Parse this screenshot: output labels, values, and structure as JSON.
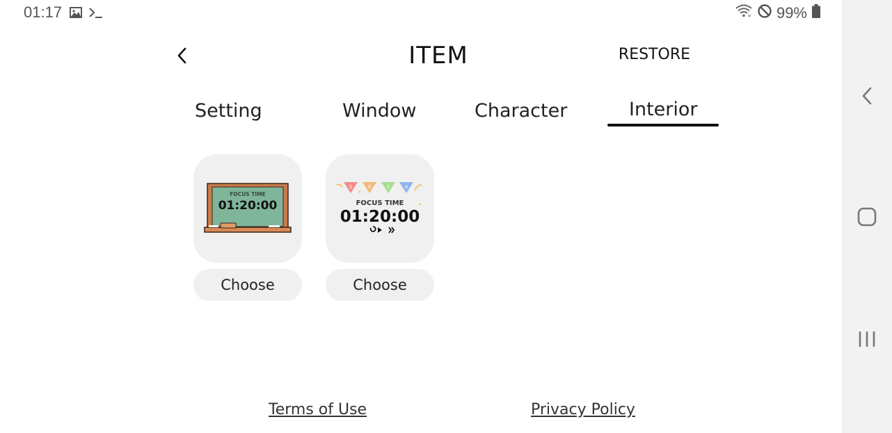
{
  "status_bar": {
    "time": "01:17",
    "battery_percent": "99%",
    "left_icons": [
      "image-icon",
      "terminal-icon"
    ],
    "right_icons": [
      "wifi-icon",
      "do-not-disturb-icon",
      "battery-icon"
    ]
  },
  "header": {
    "title": "ITEM",
    "restore_label": "RESTORE"
  },
  "tabs": [
    {
      "label": "Setting",
      "active": false
    },
    {
      "label": "Window",
      "active": false
    },
    {
      "label": "Character",
      "active": false
    },
    {
      "label": "Interior",
      "active": true
    }
  ],
  "items": [
    {
      "name": "chalkboard",
      "preview_title": "FOCUS TIME",
      "preview_time": "01:20:00",
      "choose_label": "Choose"
    },
    {
      "name": "bunting",
      "preview_title": "FOCUS TIME",
      "preview_time": "01:20:00",
      "bunting_flags": [
        "2",
        "0",
        "2",
        "4"
      ],
      "choose_label": "Choose"
    }
  ],
  "footer": {
    "terms_label": "Terms of Use",
    "privacy_label": "Privacy Policy"
  },
  "colors": {
    "card_bg": "#f0f0f0",
    "nav_bar_bg": "#f2f2f2",
    "chalkboard_green": "#7fb59a",
    "chalkboard_frame": "#c97b4a",
    "flag_red": "#f28b8b",
    "flag_orange": "#f5b87a",
    "flag_green": "#a6dc8f",
    "flag_blue": "#8fb4f0"
  }
}
